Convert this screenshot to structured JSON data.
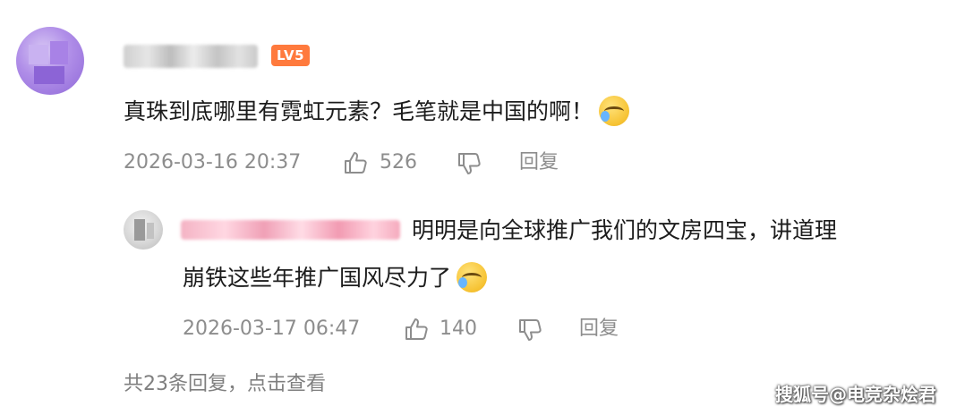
{
  "main_comment": {
    "level_badge": "LV5",
    "text": "真珠到底哪里有霓虹元素？毛笔就是中国的啊！",
    "emoji": "laugh-cry-emoji",
    "date": "2026-03-16 20:37",
    "likes": "526",
    "reply_label": "回复"
  },
  "reply_comment": {
    "text_line1": "明明是向全球推广我们的文房四宝，讲道理",
    "text_line2": "崩铁这些年推广国风尽力了",
    "emoji": "laugh-cry-emoji",
    "date": "2026-03-17 06:47",
    "likes": "140",
    "reply_label": "回复"
  },
  "more_replies_link": "共23条回复，点击查看",
  "watermark": "搜狐号@电竞杂烩君",
  "colors": {
    "badge": "#ff7a3d",
    "meta_text": "#8d8d8d",
    "body_text": "#1c1c1c"
  }
}
